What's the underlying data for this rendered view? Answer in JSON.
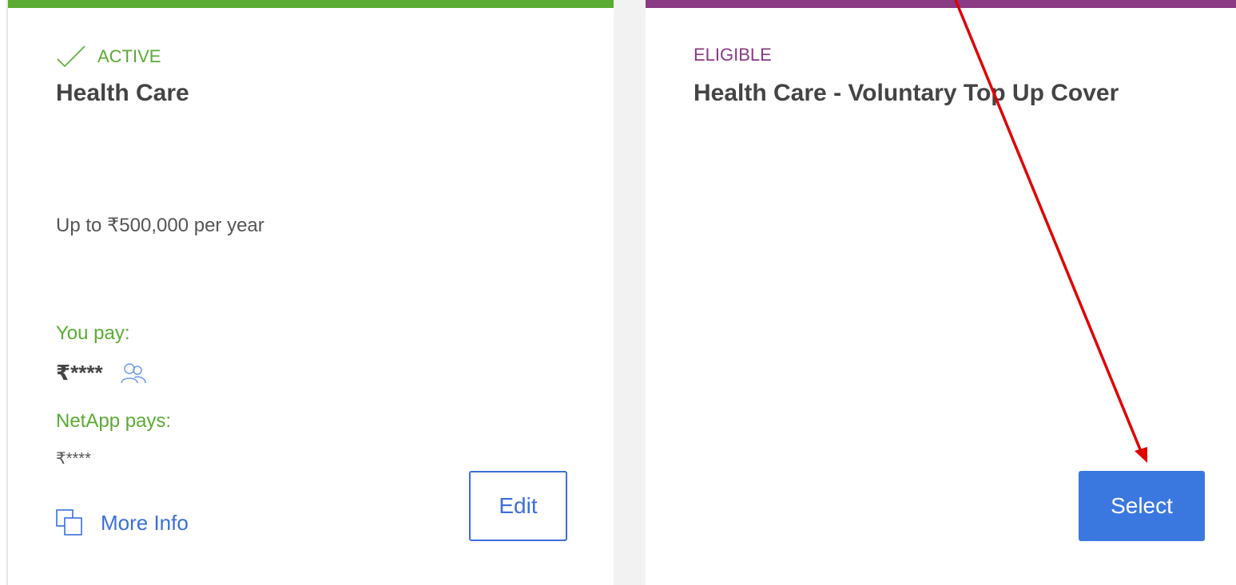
{
  "cards": [
    {
      "status": "ACTIVE",
      "title": "Health Care",
      "coverage": "Up to ₹500,000 per year",
      "you_pay_label": "You pay:",
      "you_pay_value": "₹****",
      "employer_pays_label": "NetApp pays:",
      "employer_pays_value": "₹****",
      "more_info_label": "More Info",
      "action_label": "Edit"
    },
    {
      "status": "ELIGIBLE",
      "title": "Health Care - Voluntary Top Up Cover",
      "action_label": "Select"
    }
  ],
  "colors": {
    "active_accent": "#5aab33",
    "eligible_accent": "#8a3a82",
    "primary_blue": "#3a78e0",
    "annotation_arrow": "#e00000"
  },
  "icons": {
    "status_active": "checkmark-icon",
    "dependents": "people-icon",
    "more_info": "copy-icon"
  }
}
